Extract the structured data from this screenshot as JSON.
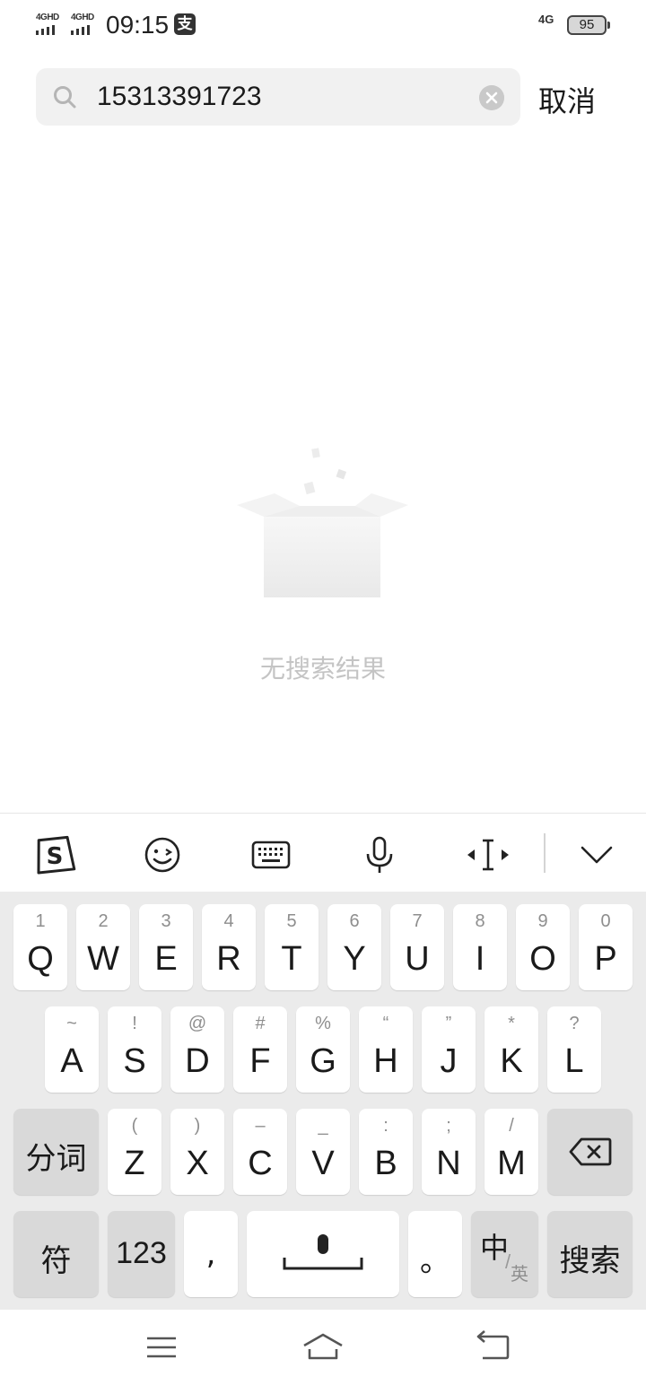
{
  "status_bar": {
    "network_1": "4GHD",
    "network_2": "4GHD",
    "time": "09:15",
    "app_badge": "支",
    "network_right": "4G",
    "battery": "95"
  },
  "search": {
    "query": "15313391723",
    "cancel_label": "取消"
  },
  "empty_state": {
    "message": "无搜索结果"
  },
  "toolbar": {
    "icons": [
      "sogou-logo-icon",
      "emoji-icon",
      "keyboard-icon",
      "microphone-icon",
      "cursor-move-icon",
      "collapse-keyboard-icon"
    ]
  },
  "keyboard": {
    "row1": [
      {
        "key": "Q",
        "hint": "1"
      },
      {
        "key": "W",
        "hint": "2"
      },
      {
        "key": "E",
        "hint": "3"
      },
      {
        "key": "R",
        "hint": "4"
      },
      {
        "key": "T",
        "hint": "5"
      },
      {
        "key": "Y",
        "hint": "6"
      },
      {
        "key": "U",
        "hint": "7"
      },
      {
        "key": "I",
        "hint": "8"
      },
      {
        "key": "O",
        "hint": "9"
      },
      {
        "key": "P",
        "hint": "0"
      }
    ],
    "row2": [
      {
        "key": "A",
        "hint": "~"
      },
      {
        "key": "S",
        "hint": "!"
      },
      {
        "key": "D",
        "hint": "@"
      },
      {
        "key": "F",
        "hint": "#"
      },
      {
        "key": "G",
        "hint": "%"
      },
      {
        "key": "H",
        "hint": "“"
      },
      {
        "key": "J",
        "hint": "”"
      },
      {
        "key": "K",
        "hint": "*"
      },
      {
        "key": "L",
        "hint": "?"
      }
    ],
    "row3": [
      {
        "key": "Z",
        "hint": "("
      },
      {
        "key": "X",
        "hint": ")"
      },
      {
        "key": "C",
        "hint": "–"
      },
      {
        "key": "V",
        "hint": "_"
      },
      {
        "key": "B",
        "hint": ":"
      },
      {
        "key": "N",
        "hint": ";"
      },
      {
        "key": "M",
        "hint": "/"
      }
    ],
    "segment_label": "分词",
    "symbols_label": "符",
    "numbers_label": "123",
    "comma_label": ",",
    "period_label": "。",
    "lang_zh": "中",
    "lang_en": "英",
    "search_label": "搜索"
  }
}
